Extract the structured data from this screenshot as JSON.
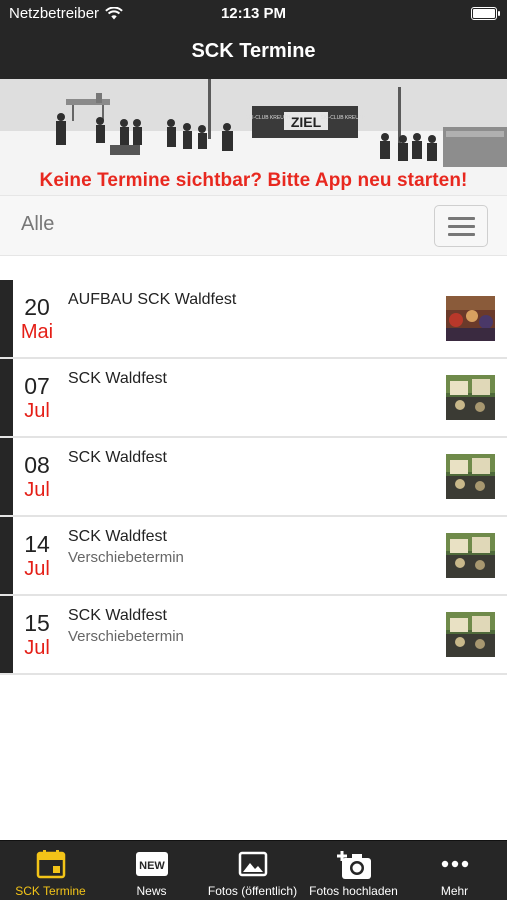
{
  "status_bar": {
    "carrier": "Netzbetreiber",
    "time": "12:13 PM",
    "battery_level": 1.0
  },
  "header": {
    "title": "SCK Termine"
  },
  "banner": {
    "text": "Keine Termine sichtbar? Bitte App neu starten!",
    "sign_ziel": "ZIEL",
    "sign_left": "SKI-CLUB KREUTH",
    "sign_right": "SKI-CLUB KREUTH"
  },
  "filter": {
    "label": "Alle",
    "menu_icon": "hamburger-icon"
  },
  "events": [
    {
      "day": "20",
      "month": "Mai",
      "title": "AUFBAU SCK Waldfest",
      "subtitle": ""
    },
    {
      "day": "07",
      "month": "Jul",
      "title": "SCK Waldfest",
      "subtitle": ""
    },
    {
      "day": "08",
      "month": "Jul",
      "title": "SCK Waldfest",
      "subtitle": ""
    },
    {
      "day": "14",
      "month": "Jul",
      "title": "SCK Waldfest",
      "subtitle": "Verschiebetermin"
    },
    {
      "day": "15",
      "month": "Jul",
      "title": "SCK Waldfest",
      "subtitle": "Verschiebetermin"
    }
  ],
  "tabbar": {
    "tabs": [
      {
        "label": "SCK Termine",
        "icon": "calendar-icon",
        "active": true
      },
      {
        "label": "News",
        "icon": "news-icon",
        "icon_text": "NEW",
        "active": false
      },
      {
        "label": "Fotos (öffentlich)",
        "icon": "photo-icon",
        "active": false
      },
      {
        "label": "Fotos hochladen",
        "icon": "camera-add-icon",
        "active": false
      },
      {
        "label": "Mehr",
        "icon": "more-icon",
        "active": false
      }
    ]
  },
  "colors": {
    "bar_dark": "#262626",
    "accent_red": "#e41e16",
    "active_tab": "#f3c418",
    "banner_red": "#e8281f"
  }
}
